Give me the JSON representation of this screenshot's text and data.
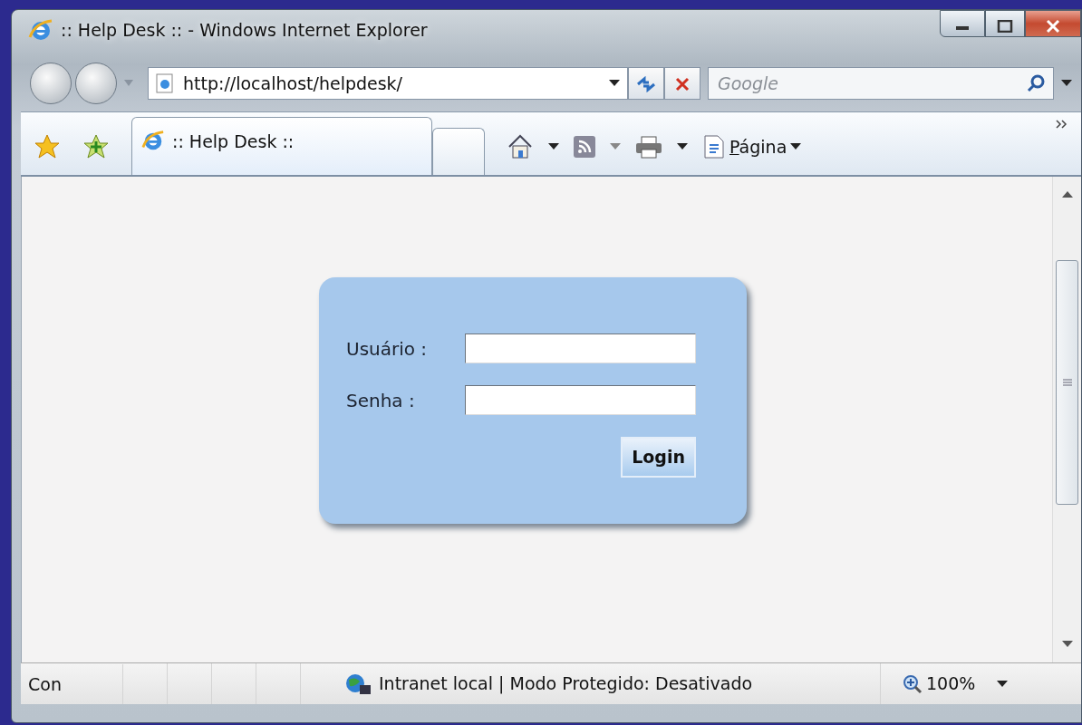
{
  "window": {
    "title": ":: Help Desk :: - Windows Internet Explorer"
  },
  "address_bar": {
    "value": "http://localhost/helpdesk/"
  },
  "search": {
    "placeholder": "Google"
  },
  "tabs": [
    {
      "label": ":: Help Desk ::",
      "selected": true
    }
  ],
  "command_bar": {
    "page_menu": "Página"
  },
  "login_form": {
    "fields": [
      {
        "label": "Usuário :"
      },
      {
        "label": "Senha :"
      }
    ],
    "button": "Login"
  },
  "status_bar": {
    "text": "Con",
    "zone": "Intranet local | Modo Protegido: Desativado",
    "zoom": "100%"
  }
}
